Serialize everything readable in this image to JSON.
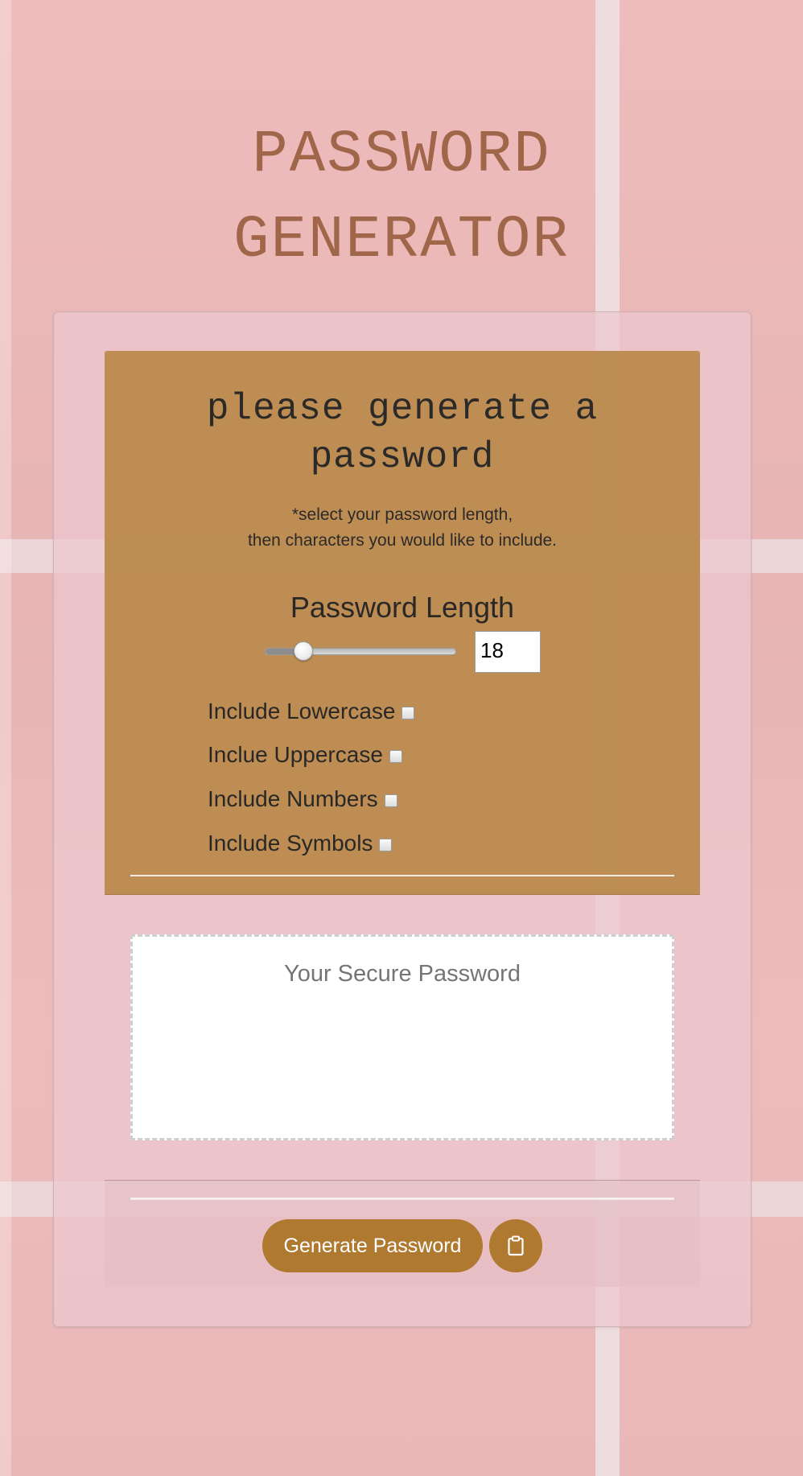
{
  "page": {
    "title": "PASSWORD GENERATOR"
  },
  "panel": {
    "heading": "please generate a password",
    "hint_line1": "*select your password length,",
    "hint_line2": "then characters you would like to include.",
    "length_label": "Password Length",
    "length_value": "18",
    "length_min": 8,
    "length_max": 128,
    "length_slider_fraction": 0.17
  },
  "options": [
    {
      "label": "Include Lowercase",
      "checked": false
    },
    {
      "label": "Inclue Uppercase",
      "checked": false
    },
    {
      "label": "Include Numbers",
      "checked": false
    },
    {
      "label": "Include Symbols",
      "checked": false
    }
  ],
  "output": {
    "placeholder": "Your Secure Password"
  },
  "actions": {
    "generate_label": "Generate Password",
    "copy_icon": "clipboard-icon"
  },
  "colors": {
    "accent": "#b07930",
    "panel": "#bb8b4f",
    "title": "#a0664a",
    "background": "#eab9b9"
  }
}
